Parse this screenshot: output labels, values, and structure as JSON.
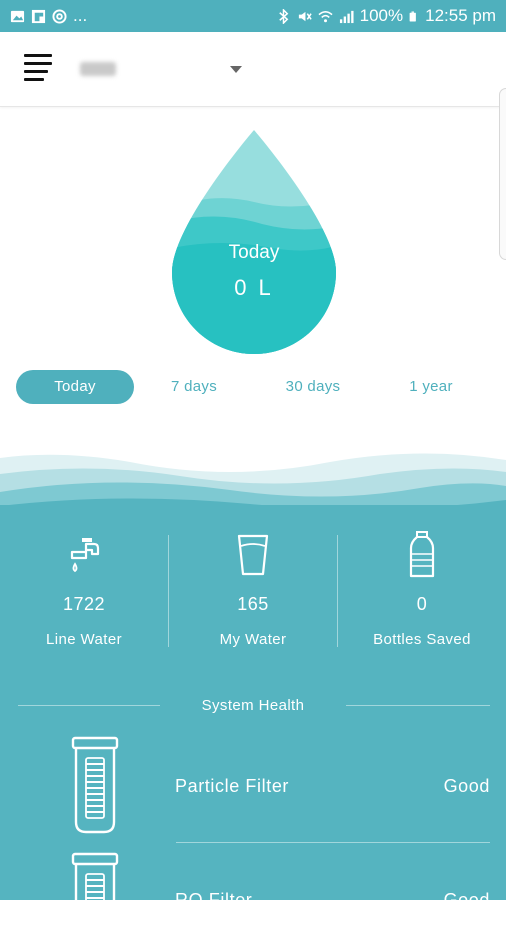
{
  "status_bar": {
    "left_icons": [
      "image-icon",
      "flipboard-icon",
      "at-icon"
    ],
    "overflow": "...",
    "right_icons": [
      "bluetooth-icon",
      "mute-icon",
      "wifi-icon",
      "signal-icon",
      "battery-icon"
    ],
    "battery": "100%",
    "time": "12:55 pm"
  },
  "app_bar": {
    "menu_icon": "hamburger-menu-icon",
    "dropdown_icon": "caret-down-icon"
  },
  "usage": {
    "period_label": "Today",
    "value": "0 L"
  },
  "range_tabs": [
    {
      "label": "Today",
      "active": true
    },
    {
      "label": "7 days",
      "active": false
    },
    {
      "label": "30 days",
      "active": false
    },
    {
      "label": "1 year",
      "active": false
    }
  ],
  "stats": [
    {
      "icon": "faucet-icon",
      "value": "1722",
      "label": "Line Water"
    },
    {
      "icon": "glass-icon",
      "value": "165",
      "label": "My Water"
    },
    {
      "icon": "bottle-icon",
      "value": "0",
      "label": "Bottles Saved"
    }
  ],
  "system_health": {
    "title": "System Health",
    "filters": [
      {
        "icon": "filter-cartridge-icon",
        "name": "Particle Filter",
        "status": "Good"
      },
      {
        "icon": "filter-cartridge-icon",
        "name": "RO Filter",
        "status": "Good"
      }
    ]
  },
  "colors": {
    "accent": "#4fb0bd",
    "panel": "#55b4c0",
    "drop_light": "#8fdcdc",
    "drop_dark": "#26c0c0"
  }
}
